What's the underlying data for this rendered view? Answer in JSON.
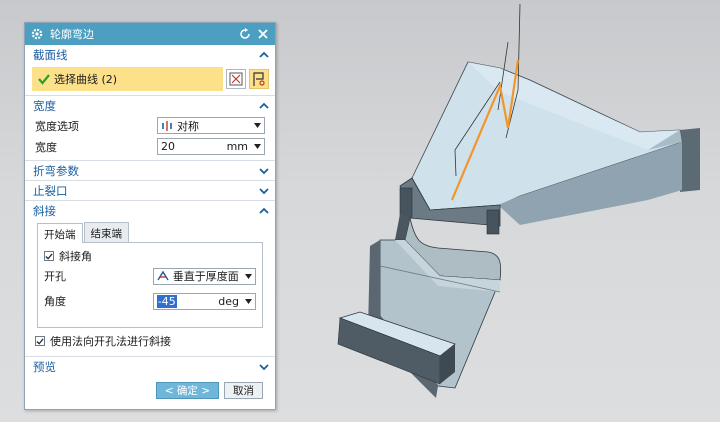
{
  "dialog": {
    "title": "轮廓弯边",
    "sections": {
      "section_curve": "截面线",
      "width": "宽度",
      "bend_params": "折弯参数",
      "relief": "止裂口",
      "miter": "斜接",
      "preview": "预览"
    },
    "selection": {
      "label": "选择曲线 (2)"
    },
    "width_option": {
      "label": "宽度选项",
      "value": "对称"
    },
    "width_value": {
      "label": "宽度",
      "value": "20",
      "unit": "mm"
    },
    "tabs": [
      "开始端",
      "结束端"
    ],
    "miter_angle_checkbox": "斜接角",
    "hole": {
      "label": "开孔",
      "value": "垂直于厚度面"
    },
    "angle": {
      "label": "角度",
      "value": "-45",
      "unit": "deg"
    },
    "use_normal_checkbox": "使用法向开孔法进行斜接",
    "buttons": {
      "ok": "< 确定 >",
      "cancel": "取消"
    }
  },
  "colors": {
    "titlebar": "#4c9fc0",
    "section_text": "#1a5e9e",
    "selection_highlight": "#fce08a",
    "highlight_box": "#e01d1d",
    "curve_orange": "#f0962a",
    "part_face": "#c5dbe6"
  },
  "icons": [
    "gear-icon",
    "reset-icon",
    "close-icon",
    "check-icon",
    "curve-select-icon",
    "flag-icon",
    "chevron-up-icon",
    "chevron-down-icon",
    "symmetric-icon",
    "hole-icon",
    "dropdown-arrow-icon"
  ]
}
